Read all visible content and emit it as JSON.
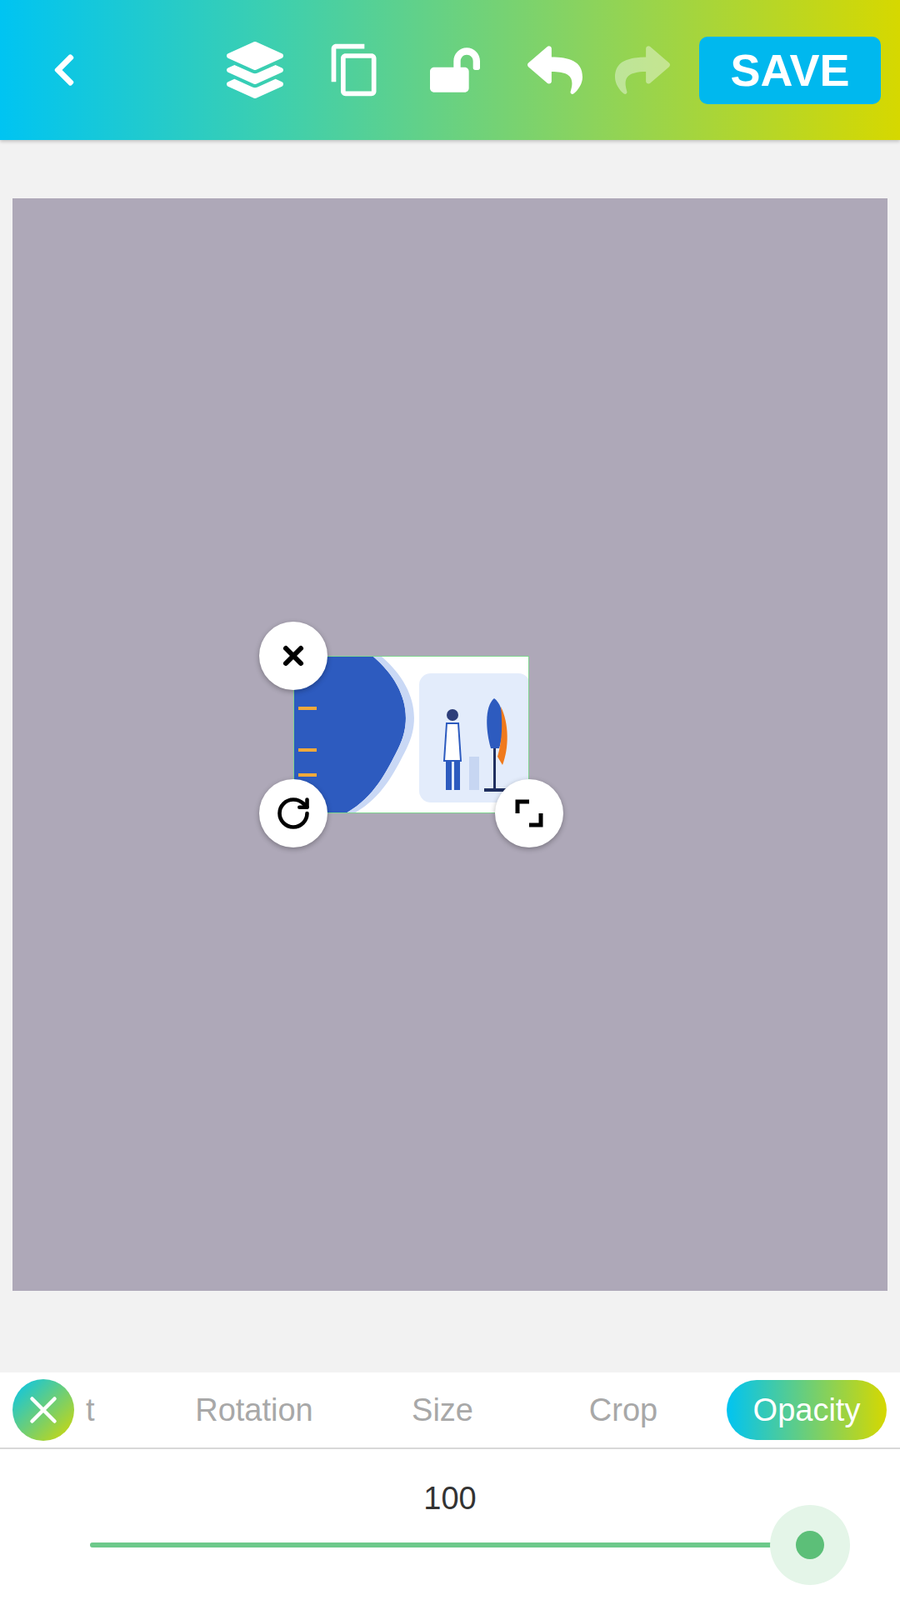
{
  "toolbar": {
    "undo_disabled": false,
    "redo_disabled": true,
    "save": "SAVE"
  },
  "tools": [
    {
      "label": "t",
      "selected": false
    },
    {
      "label": "Rotation",
      "selected": false
    },
    {
      "label": "Size",
      "selected": false
    },
    {
      "label": "Crop",
      "selected": false
    },
    {
      "label": "Opacity",
      "selected": true
    }
  ],
  "opacity": {
    "reading": "100",
    "level": 1
  }
}
